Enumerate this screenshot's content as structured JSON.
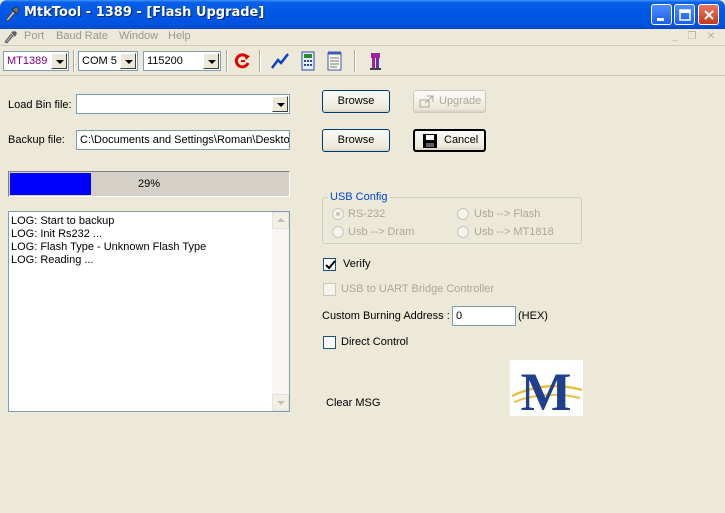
{
  "window": {
    "title": "MtkTool - 1389 - [Flash Upgrade]"
  },
  "menu": {
    "items": [
      "Port",
      "Baud Rate",
      "Window",
      "Help"
    ]
  },
  "toolbar": {
    "chip_value": "MT1389",
    "port_value": "COM 5",
    "baud_value": "115200",
    "icons": [
      "refresh-icon",
      "chart-icon",
      "calculator-icon",
      "notepad-icon",
      "info-icon"
    ]
  },
  "load_bin": {
    "label": "Load Bin file:",
    "value": ""
  },
  "backup": {
    "label": "Backup file:",
    "value": "C:\\Documents and Settings\\Roman\\Deskto"
  },
  "buttons": {
    "browse_1": "Browse",
    "browse_2": "Browse",
    "upgrade": "Upgrade",
    "cancel": "Cancel",
    "clear_msg": "Clear MSG"
  },
  "progress": {
    "percent_text": "29%",
    "fraction": 0.29,
    "color": "#0000ff"
  },
  "log": {
    "lines": [
      "LOG: Start to backup",
      "LOG: Init Rs232 ...",
      "LOG: Flash Type - Unknown Flash Type",
      "LOG: Reading ..."
    ]
  },
  "usb_config": {
    "title": "USB Config",
    "options": [
      "RS-232",
      "Usb --> Flash",
      "Usb --> Dram",
      "Usb --> MT1818"
    ],
    "selected": "RS-232"
  },
  "options": {
    "verify_label": "Verify",
    "verify_checked": true,
    "uart_label": "USB to UART Bridge Controller",
    "uart_checked": false,
    "direct_label": "Direct Control",
    "direct_checked": false
  },
  "address": {
    "label": "Custom Burning  Address :",
    "value": "0",
    "unit": "(HEX)"
  },
  "logo": {
    "letter": "M"
  }
}
